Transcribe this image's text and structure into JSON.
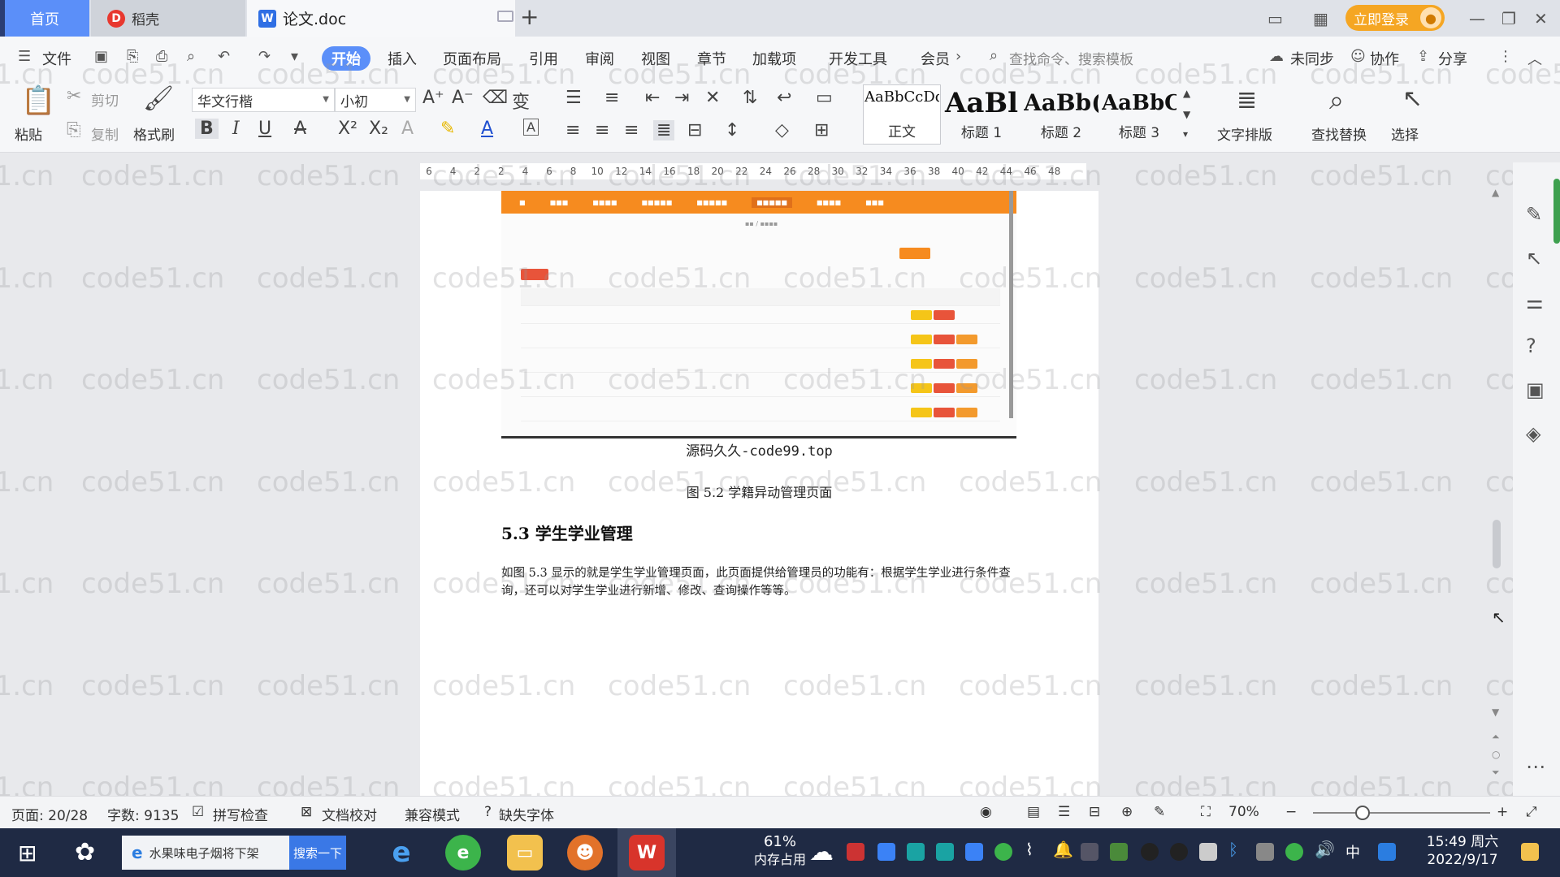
{
  "tabs": {
    "home": "首页",
    "daoke": "稻壳",
    "document": "论文.doc",
    "login": "立即登录"
  },
  "menu": {
    "file": "文件",
    "items": [
      "开始",
      "插入",
      "页面布局",
      "引用",
      "审阅",
      "视图",
      "章节",
      "加载项",
      "开发工具",
      "会员"
    ],
    "search_placeholder": "查找命令、搜索模板",
    "sync": "未同步",
    "collab": "协作",
    "share": "分享"
  },
  "ribbon": {
    "paste": "粘贴",
    "cut": "剪切",
    "copy": "复制",
    "format_painter": "格式刷",
    "font_name": "华文行楷",
    "font_size": "小初",
    "styles": [
      {
        "preview": "AaBbCcDd",
        "label": "正文"
      },
      {
        "preview": "AaBl",
        "label": "标题 1"
      },
      {
        "preview": "AaBb(",
        "label": "标题 2"
      },
      {
        "preview": "AaBbC",
        "label": "标题 3"
      }
    ],
    "text_layout": "文字排版",
    "find_replace": "查找替换",
    "select": "选择"
  },
  "ruler": [
    "6",
    "4",
    "2",
    "2",
    "4",
    "6",
    "8",
    "10",
    "12",
    "14",
    "16",
    "18",
    "20",
    "22",
    "24",
    "26",
    "28",
    "30",
    "32",
    "34",
    "36",
    "38",
    "40",
    "42",
    "44",
    "46",
    "48"
  ],
  "document": {
    "image_caption_watermark": "源码久久-code99.top",
    "figure_caption": "图 5.2  学籍异动管理页面",
    "section_heading": "5.3 学生学业管理",
    "paragraph_line1": "如图 5.3 显示的就是学生学业管理页面，此页面提供给管理员的功能有：根据学生学业进行条件查",
    "paragraph_line2": "询，还可以对学生学业进行新增、修改、查询操作等等。"
  },
  "watermark_text": "code51.cn",
  "status": {
    "page": "页面: 20/28",
    "words": "字数: 9135",
    "spell": "拼写检查",
    "proof": "文档校对",
    "compat": "兼容模式",
    "missing_font": "缺失字体",
    "zoom": "70%",
    "zoom_level": 0.28
  },
  "taskbar": {
    "search_text": "水果味电子烟将下架",
    "search_button": "搜索一下",
    "memory_percent": "61%",
    "memory_label": "内存占用",
    "ime": "中",
    "time": "15:49 周六",
    "date": "2022/9/17"
  },
  "colors": {
    "accent_blue": "#5b8ff9",
    "login_orange": "#f5a623",
    "screenshot_nav_orange": "#f68b1f",
    "taskbar": "#1f2a44"
  }
}
